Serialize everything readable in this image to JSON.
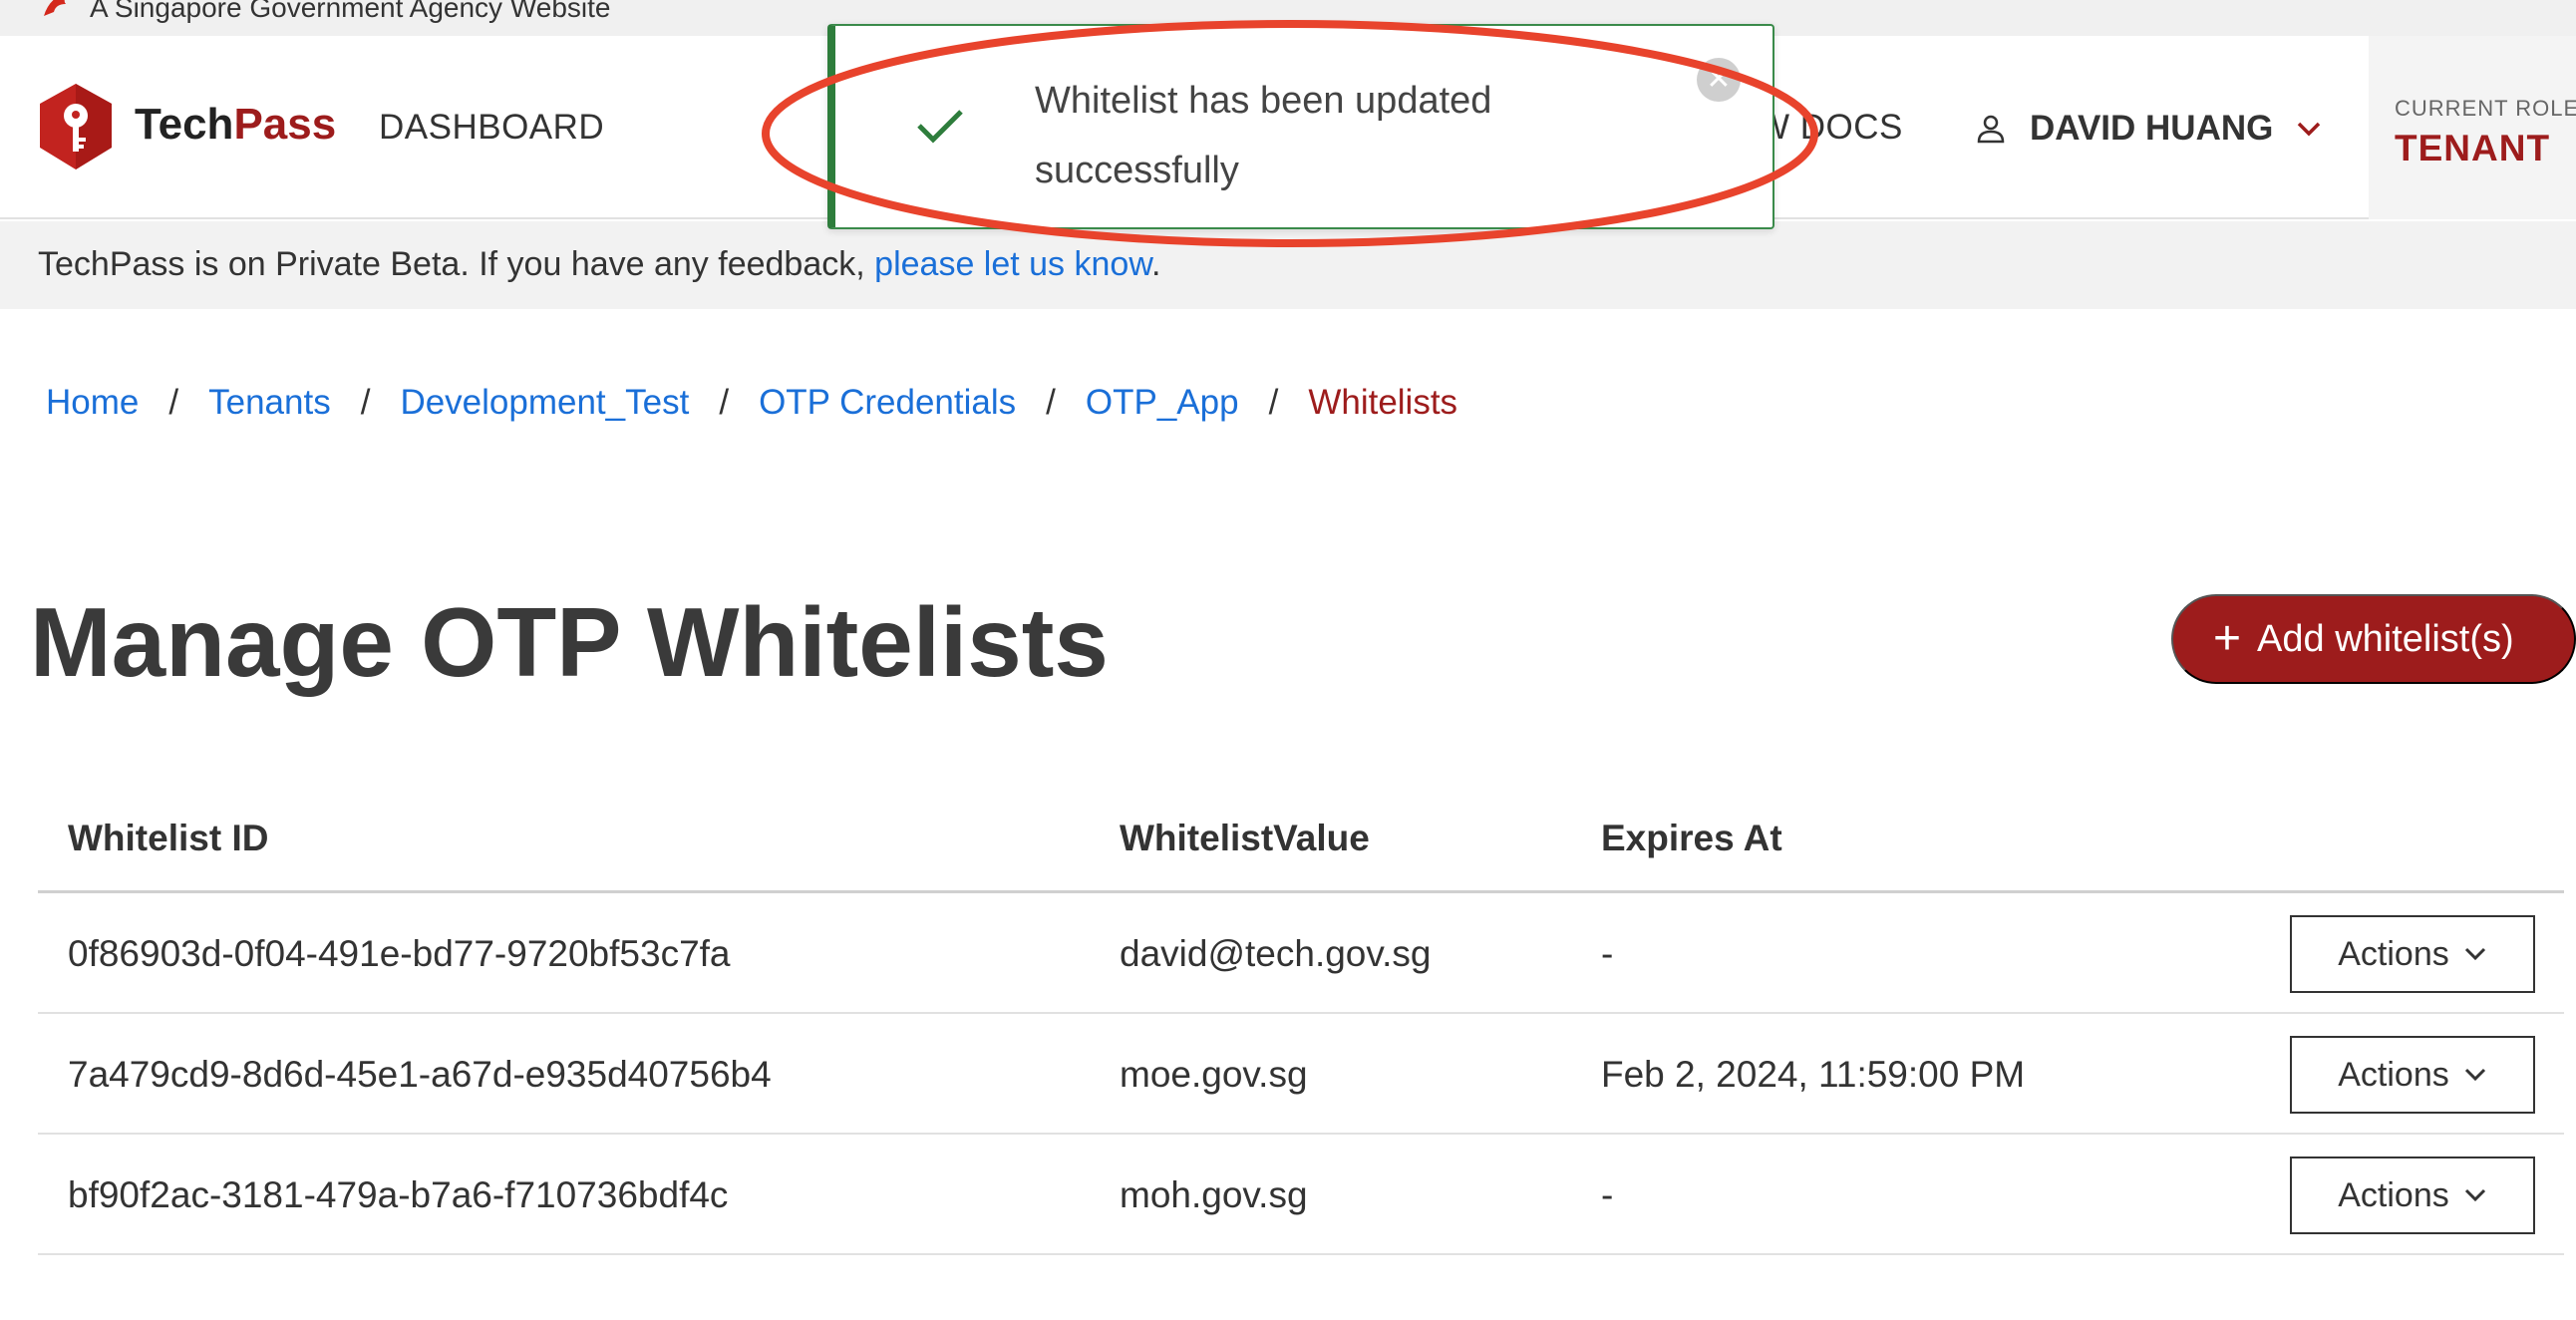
{
  "masthead": {
    "text": "A Singapore Government Agency Website"
  },
  "header": {
    "brand_part1": "Tech",
    "brand_part2": "Pass",
    "nav_dashboard": "DASHBOARD",
    "nav_docs": "W DOCS",
    "user_name": "DAVID HUANG",
    "role_label": "CURRENT ROLE",
    "role_value": "TENANT"
  },
  "banner": {
    "text": "TechPass is on Private Beta. If you have any feedback, ",
    "link": "please let us know",
    "suffix": "."
  },
  "toast": {
    "message": "Whitelist has been updated successfully",
    "close_glyph": "✕"
  },
  "breadcrumb": {
    "items": [
      "Home",
      "Tenants",
      "Development_Test",
      "OTP Credentials",
      "OTP_App"
    ],
    "current": "Whitelists",
    "separator": "/"
  },
  "page": {
    "title": "Manage OTP Whitelists",
    "add_button": "Add whitelist(s)",
    "add_icon": "+"
  },
  "table": {
    "columns": [
      "Whitelist ID",
      "WhitelistValue",
      "Expires At"
    ],
    "rows": [
      {
        "id": "0f86903d-0f04-491e-bd77-9720bf53c7fa",
        "value": "david@tech.gov.sg",
        "expires": "-",
        "action": "Actions"
      },
      {
        "id": "7a479cd9-8d6d-45e1-a67d-e935d40756b4",
        "value": "moe.gov.sg",
        "expires": "Feb 2, 2024, 11:59:00 PM",
        "action": "Actions"
      },
      {
        "id": "bf90f2ac-3181-479a-b7a6-f710736bdf4c",
        "value": "moh.gov.sg",
        "expires": "-",
        "action": "Actions"
      }
    ]
  },
  "colors": {
    "brand_red": "#9d1c1c",
    "link_blue": "#1a6fd8",
    "success_green": "#2e7d3c",
    "annotation_red": "#e8432c"
  }
}
